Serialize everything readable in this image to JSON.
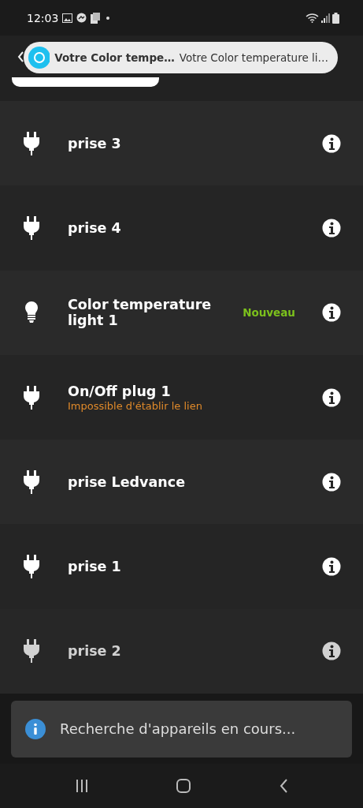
{
  "status_bar": {
    "time": "12:03"
  },
  "notification": {
    "title": "Votre Color tempe…",
    "text": "Votre Color temperature li…"
  },
  "devices": [
    {
      "kind": "plug",
      "name": "prise 3"
    },
    {
      "kind": "plug",
      "name": "prise 4"
    },
    {
      "kind": "bulb",
      "name": "Color temperature light 1",
      "badge": "Nouveau"
    },
    {
      "kind": "plug",
      "name": "On/Off plug 1",
      "subtitle": "Impossible d'établir le lien"
    },
    {
      "kind": "plug",
      "name": "prise Ledvance"
    },
    {
      "kind": "plug",
      "name": "prise 1"
    },
    {
      "kind": "plug",
      "name": "prise 2"
    }
  ],
  "snackbar": {
    "text": "Recherche d'appareils en cours..."
  }
}
